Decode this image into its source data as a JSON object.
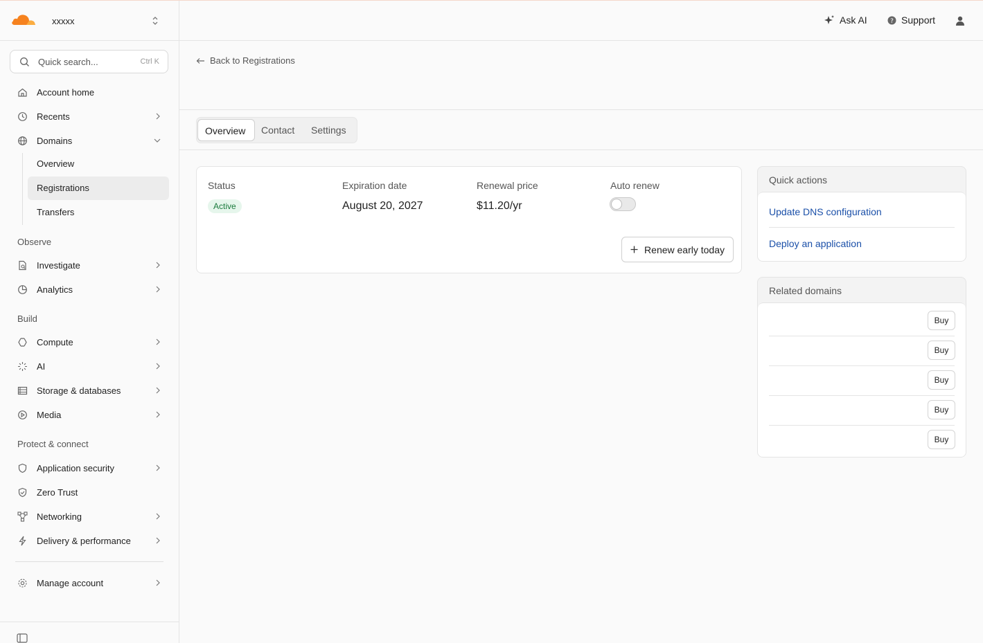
{
  "account": {
    "name": "xxxxx"
  },
  "search": {
    "placeholder": "Quick search...",
    "shortcut": "Ctrl K"
  },
  "sidebar": {
    "items": [
      {
        "label": "Account home"
      },
      {
        "label": "Recents"
      },
      {
        "label": "Domains"
      }
    ],
    "domains_sub": [
      {
        "label": "Overview"
      },
      {
        "label": "Registrations"
      },
      {
        "label": "Transfers"
      }
    ],
    "sections": {
      "observe": "Observe",
      "build": "Build",
      "protect": "Protect & connect"
    },
    "observe_items": [
      {
        "label": "Investigate"
      },
      {
        "label": "Analytics"
      }
    ],
    "build_items": [
      {
        "label": "Compute"
      },
      {
        "label": "AI"
      },
      {
        "label": "Storage & databases"
      },
      {
        "label": "Media"
      }
    ],
    "protect_items": [
      {
        "label": "Application security"
      },
      {
        "label": "Zero Trust"
      },
      {
        "label": "Networking"
      },
      {
        "label": "Delivery & performance"
      }
    ],
    "manage": {
      "label": "Manage account"
    }
  },
  "topbar": {
    "ask_ai": "Ask AI",
    "support": "Support"
  },
  "back_link": "Back to Registrations",
  "tabs": [
    {
      "label": "Overview"
    },
    {
      "label": "Contact"
    },
    {
      "label": "Settings"
    }
  ],
  "status_card": {
    "status_label": "Status",
    "status_value": "Active",
    "expiration_label": "Expiration date",
    "expiration_value": "August 20, 2027",
    "renewal_label": "Renewal price",
    "renewal_value": "$11.20/yr",
    "auto_renew_label": "Auto renew",
    "auto_renew_on": false,
    "renew_button": "Renew early today"
  },
  "quick_actions": {
    "title": "Quick actions",
    "links": [
      "Update DNS configuration",
      "Deploy an application"
    ]
  },
  "related_domains": {
    "title": "Related domains",
    "buy_label": "Buy",
    "rows": 5
  },
  "colors": {
    "brand_orange": "#f6821f",
    "link_blue": "#1a4fa8",
    "active_badge_bg": "#e6f6ec",
    "active_badge_text": "#1a7a3c"
  }
}
